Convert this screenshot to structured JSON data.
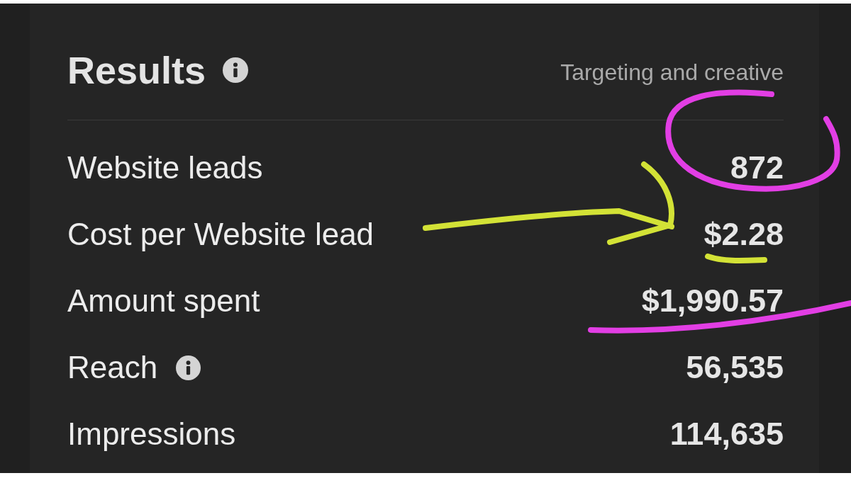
{
  "header": {
    "title": "Results",
    "title_info": true,
    "subtitle": "Targeting and creative"
  },
  "rows": [
    {
      "label": "Website leads",
      "info": false,
      "value": "872",
      "marks": [
        {
          "kind": "circle",
          "color": "#e23ee4"
        }
      ]
    },
    {
      "label": "Cost per Website lead",
      "info": false,
      "value": "$2.28",
      "marks": [
        {
          "kind": "arrow",
          "color": "#d3e236"
        },
        {
          "kind": "underline",
          "color": "#d3e236"
        }
      ]
    },
    {
      "label": "Amount spent",
      "info": false,
      "value": "$1,990.57",
      "marks": [
        {
          "kind": "long_underline",
          "color": "#e23ee4"
        }
      ]
    },
    {
      "label": "Reach",
      "info": true,
      "value": "56,535"
    },
    {
      "label": "Impressions",
      "info": false,
      "value": "114,635"
    }
  ]
}
